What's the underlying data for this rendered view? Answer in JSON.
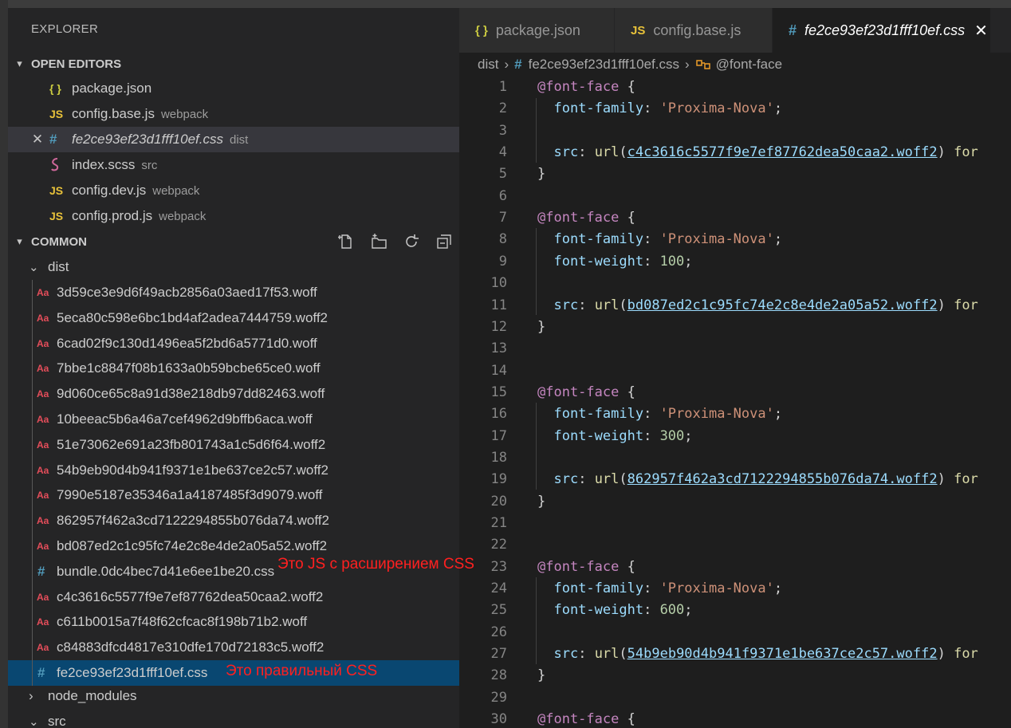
{
  "sidebar": {
    "title": "EXPLORER",
    "open_editors": {
      "header": "OPEN EDITORS",
      "items": [
        {
          "icon": "{}",
          "label": "package.json",
          "desc": ""
        },
        {
          "icon": "JS",
          "label": "config.base.js",
          "desc": "webpack"
        },
        {
          "icon": "#",
          "label": "fe2ce93ef23d1fff10ef.css",
          "desc": "dist"
        },
        {
          "icon": "sass",
          "label": "index.scss",
          "desc": "src"
        },
        {
          "icon": "JS",
          "label": "config.dev.js",
          "desc": "webpack"
        },
        {
          "icon": "JS",
          "label": "config.prod.js",
          "desc": "webpack"
        }
      ]
    },
    "common": {
      "header": "COMMON",
      "dist_folder": "dist",
      "files": [
        "3d59ce3e9d6f49acb2856a03aed17f53.woff",
        "5eca80c598e6bc1bd4af2adea7444759.woff2",
        "6cad02f9c130d1496ea5f2bd6a5771d0.woff",
        "7bbe1c8847f08b1633a0b59bcbe65ce0.woff",
        "9d060ce65c8a91d38e218db97dd82463.woff",
        "10beeac5b6a46a7cef4962d9bffb6aca.woff",
        "51e73062e691a23fb801743a1c5d6f64.woff2",
        "54b9eb90d4b941f9371e1be637ce2c57.woff2",
        "7990e5187e35346a1a4187485f3d9079.woff",
        "862957f462a3cd7122294855b076da74.woff2",
        "bd087ed2c1c95fc74e2c8e4de2a05a52.woff2",
        "bundle.0dc4bec7d41e6ee1be20.css",
        "c4c3616c5577f9e7ef87762dea50caa2.woff2",
        "c611b0015a7f48f62cfcac8f198b71b2.woff",
        "c84883dfcd4817e310dfe170d72183c5.woff2",
        "fe2ce93ef23d1fff10ef.css"
      ],
      "node_modules": "node_modules",
      "src": "src"
    },
    "annotations": {
      "bundle": "Это JS с расширением CSS",
      "correct": "Это правильный CSS"
    }
  },
  "tabs": [
    {
      "icon": "{}",
      "label": "package.json"
    },
    {
      "icon": "JS",
      "label": "config.base.js"
    },
    {
      "icon": "#",
      "label": "fe2ce93ef23d1fff10ef.css"
    }
  ],
  "breadcrumb": {
    "folder": "dist",
    "file": "fe2ce93ef23d1fff10ef.css",
    "symbol": "@font-face"
  },
  "editor": {
    "font_family_value": "'Proxima-Nova'",
    "urls": {
      "l4": "c4c3616c5577f9e7ef87762dea50caa2.woff2",
      "l11": "bd087ed2c1c95fc74e2c8e4de2a05a52.woff2",
      "l19": "862957f462a3cd7122294855b076da74.woff2",
      "l27": "54b9eb90d4b941f9371e1be637ce2c57.woff2"
    },
    "weights": {
      "l9": "100",
      "l17": "300",
      "l25": "600"
    }
  },
  "colors": {
    "accent_selection": "#094771",
    "annotation": "#ff2020",
    "js_icon": "#e8c23a",
    "json_icon": "#cbcb41",
    "css_icon": "#519aba"
  }
}
